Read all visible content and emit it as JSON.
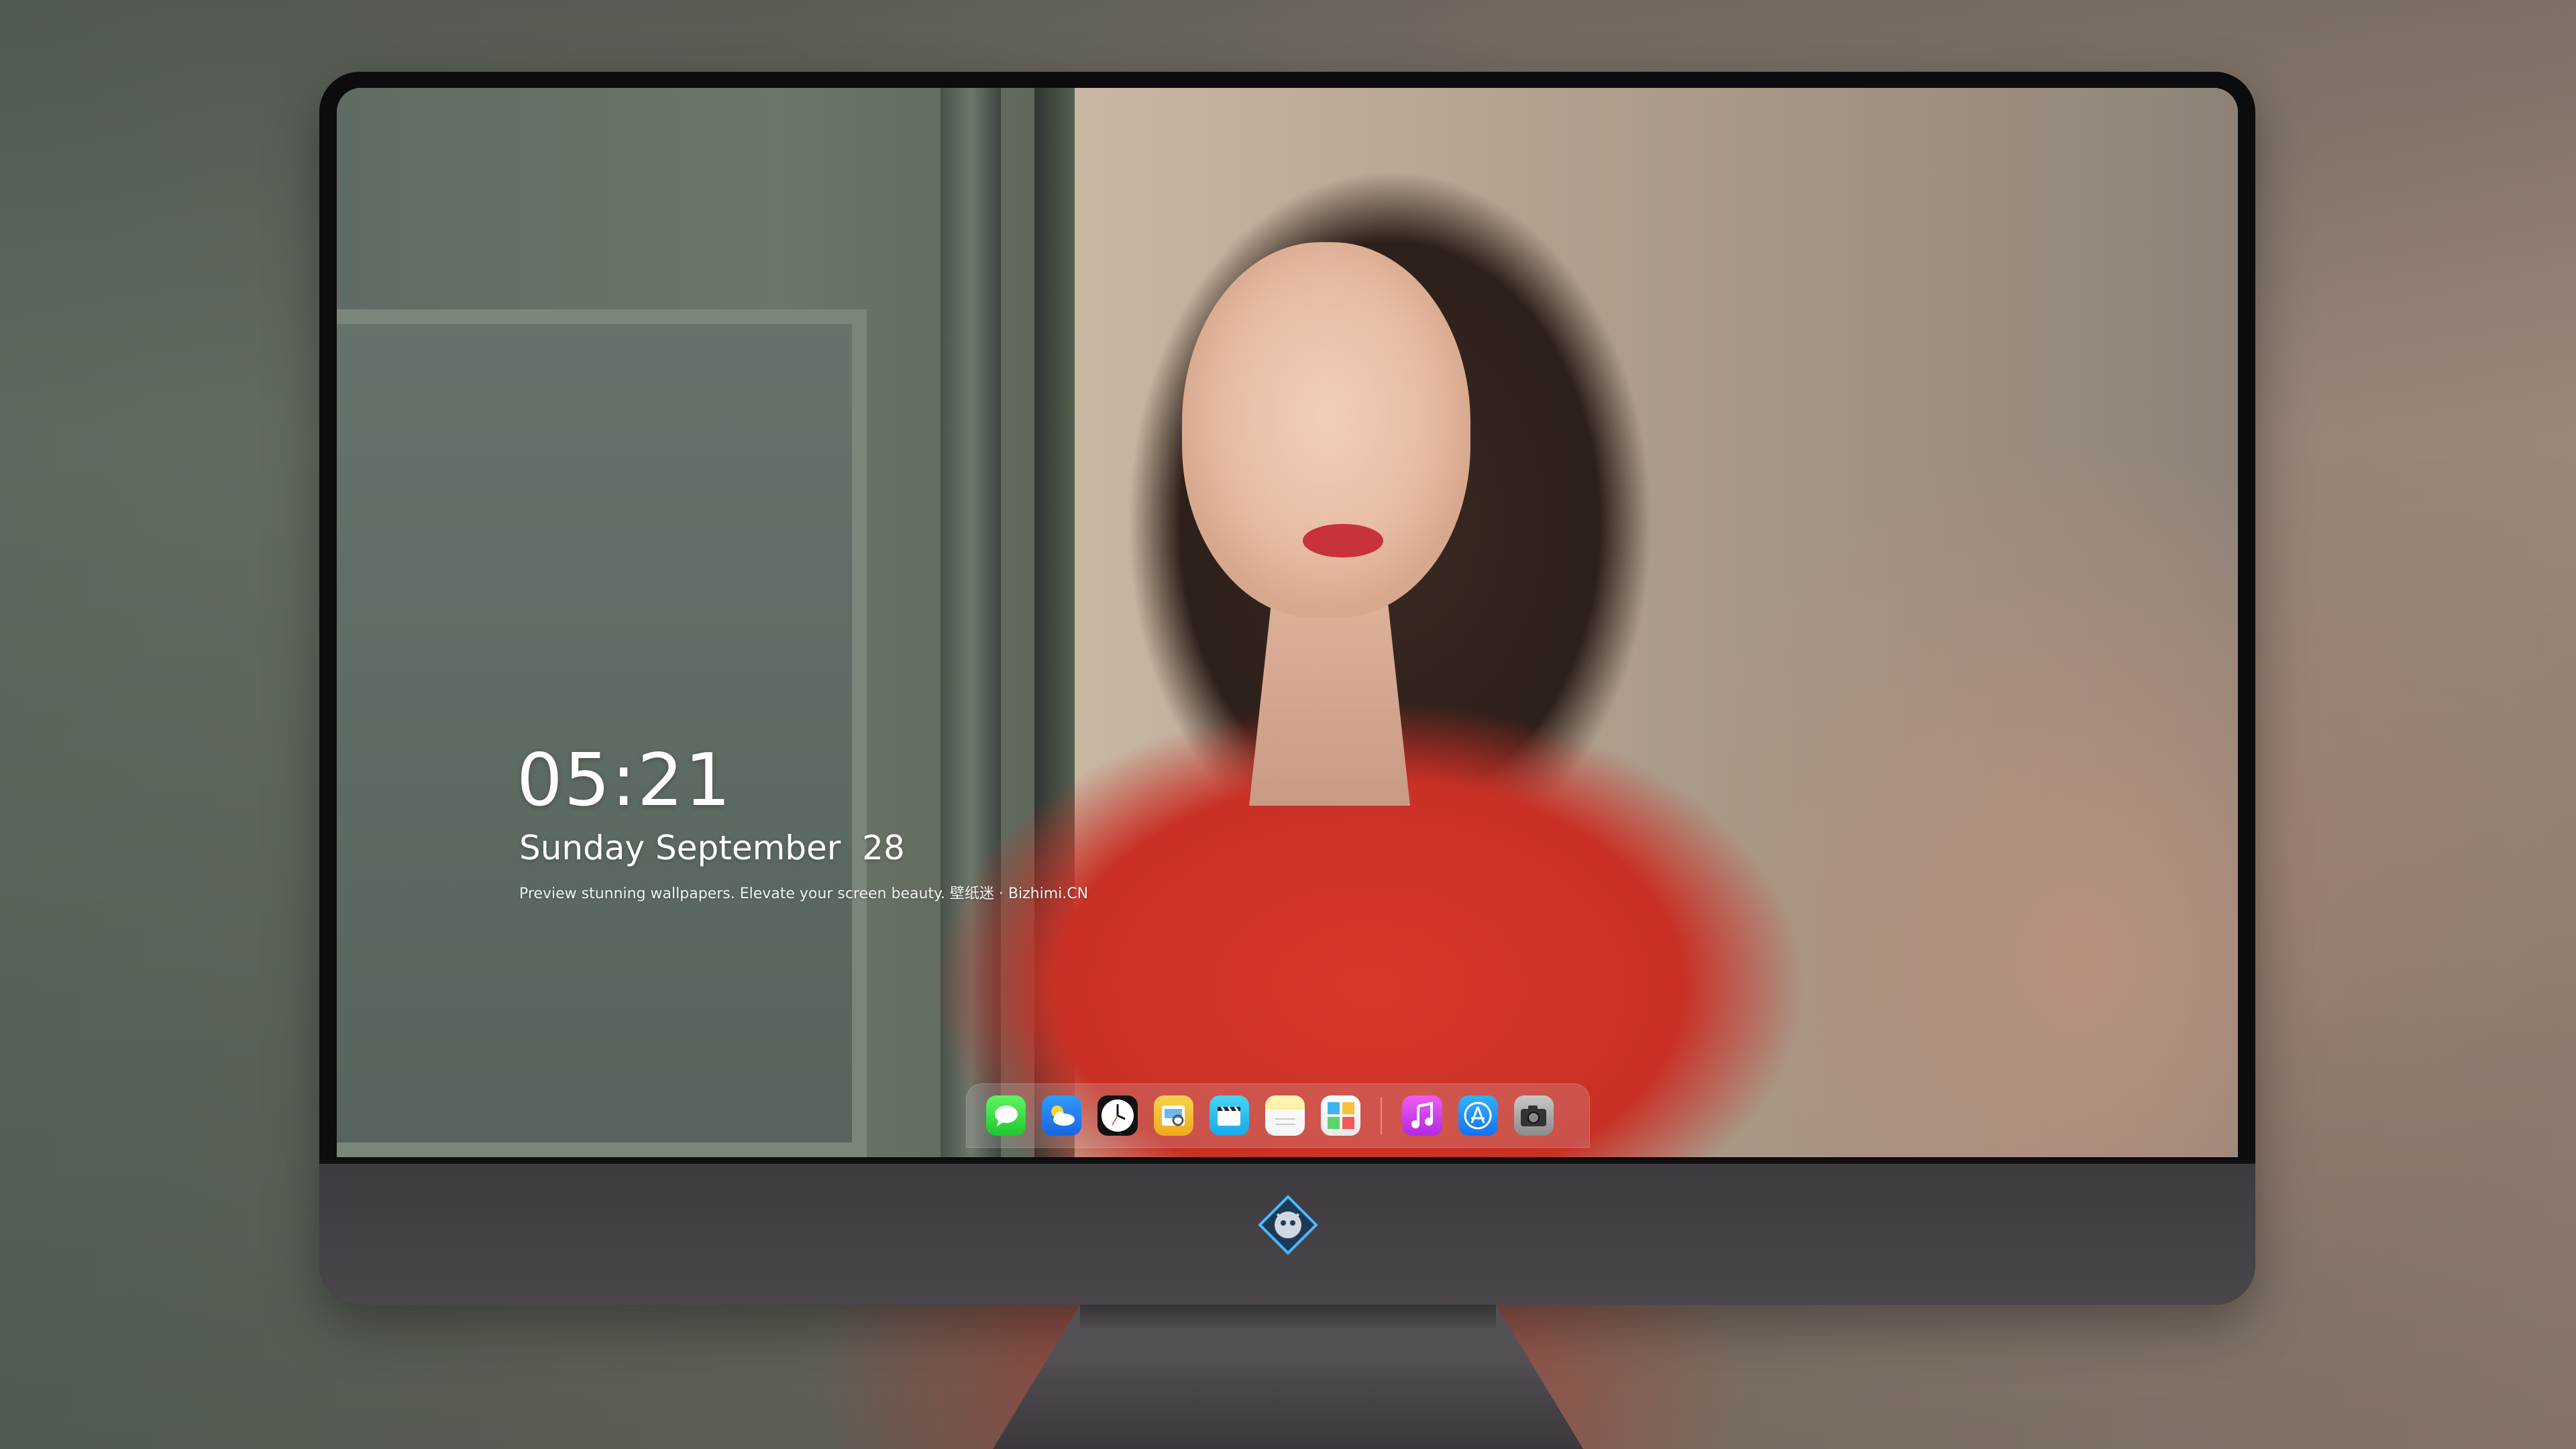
{
  "lock_screen": {
    "time": "05:21",
    "date": "Sunday September  28",
    "tagline": "Preview stunning wallpapers. Elevate your screen beauty. 壁纸迷 · Bizhimi.CN"
  },
  "dock": {
    "items": [
      {
        "icon": "messages-icon"
      },
      {
        "icon": "weather-icon"
      },
      {
        "icon": "clock-icon"
      },
      {
        "icon": "preview-icon"
      },
      {
        "icon": "clips-icon"
      },
      {
        "icon": "notes-icon"
      },
      {
        "icon": "photos-icon"
      },
      {
        "icon": "music-icon"
      },
      {
        "icon": "app-store-icon"
      },
      {
        "icon": "camera-icon"
      }
    ]
  },
  "colors": {
    "monitor_bezel": "#0c0c0e",
    "monitor_chin": "#4a464c",
    "accent_red": "#d8382c",
    "text": "#ffffff"
  }
}
